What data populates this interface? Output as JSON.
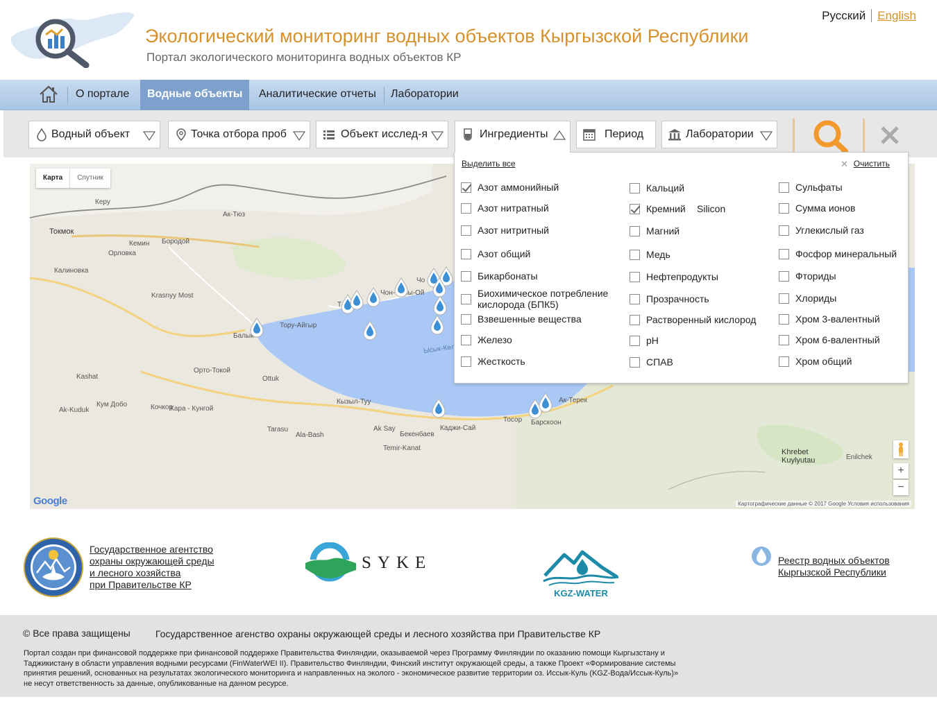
{
  "header": {
    "title": "Экологический мониторинг водных объектов Кыргызской Республики",
    "subtitle": "Портал экологического мониторинга водных объектов КР",
    "languages": {
      "ru": "Русский",
      "en": "English",
      "active": "en"
    }
  },
  "nav": {
    "items": [
      {
        "label": "О портале"
      },
      {
        "label": "Водные объекты",
        "active": true
      },
      {
        "label": "Аналитические отчеты"
      },
      {
        "label": "Лаборатории"
      }
    ]
  },
  "filters": {
    "water_object": "Водный объект",
    "sampling_point": "Точка отбора проб",
    "research_object": "Объект исслед-я",
    "ingredients": "Ингредиенты",
    "period": "Период",
    "laboratories": "Лаборатории"
  },
  "dropdown": {
    "select_all": "Выделить все",
    "clear": "Очистить",
    "columns": [
      [
        {
          "label": "Азот аммонийный",
          "checked": true
        },
        {
          "label": "Азот нитратный",
          "checked": false
        },
        {
          "label": "Азот нитритный",
          "checked": false
        },
        {
          "label": "Азот общий",
          "checked": false
        },
        {
          "label": "Бикарбонаты",
          "checked": false
        },
        {
          "label": "Биохимическое потребление кислорода (БПК5)",
          "checked": false
        },
        {
          "label": "Взвешенные вещества",
          "checked": false
        },
        {
          "label": "Железо",
          "checked": false
        },
        {
          "label": "Жесткость",
          "checked": false
        }
      ],
      [
        {
          "label": "Кальций",
          "checked": false
        },
        {
          "label": "Кремний",
          "checked": true,
          "extra": "Silicon"
        },
        {
          "label": "Магний",
          "checked": false
        },
        {
          "label": "Медь",
          "checked": false
        },
        {
          "label": "Нефтепродукты",
          "checked": false
        },
        {
          "label": "Прозрачность",
          "checked": false
        },
        {
          "label": "Растворенный кислород",
          "checked": false
        },
        {
          "label": "pH",
          "checked": false
        },
        {
          "label": "СПАВ",
          "checked": false
        }
      ],
      [
        {
          "label": "Сульфаты",
          "checked": false
        },
        {
          "label": "Сумма ионов",
          "checked": false
        },
        {
          "label": "Углекислый газ",
          "checked": false
        },
        {
          "label": "Фосфор минеральный",
          "checked": false
        },
        {
          "label": "Фториды",
          "checked": false
        },
        {
          "label": "Хлориды",
          "checked": false
        },
        {
          "label": "Хром 3-валентный",
          "checked": false
        },
        {
          "label": "Хром 6-валентный",
          "checked": false
        },
        {
          "label": "Хром общий",
          "checked": false
        }
      ]
    ]
  },
  "map": {
    "type_map": "Карта",
    "type_satellite": "Спутник",
    "lake_label": "Ысык-Көл",
    "places": [
      "Керу",
      "Ак-Тюз",
      "Токмок",
      "Кемин",
      "Бородой",
      "Орловка",
      "Калиновка",
      "Krasnyy Most",
      "Тору-Айгыр",
      "Балык",
      "Чо",
      "Чон-Сары-Ой",
      "Т",
      "Орто-Токой",
      "Ottuk",
      "Kashat",
      "Кум Добо",
      "Кочкор",
      "Кара - Кунгой",
      "Ak-Kuduk",
      "Кызыл-Туу",
      "Tarasu",
      "Ala-Bash",
      "Ak Say",
      "Бекенбаев",
      "Каджи-Сай",
      "Temir-Kanat",
      "Тосор",
      "Барскоон",
      "Ак-Терек",
      "Khrebet Kuylyutau",
      "Enilchek"
    ],
    "zoom_in": "+",
    "zoom_out": "−",
    "google": "Google",
    "attribution": "Картографические данные © 2017 Google   Условия использования"
  },
  "partners": {
    "agency_lines": [
      "Государственное агентство",
      "охраны окружающей среды",
      "и лесного хозяйства",
      "при Правительстве КР"
    ],
    "syke": "SYKE",
    "kgz_water": "KGZ-WATER",
    "registry_lines": [
      "Реестр водных объектов",
      "Кыргызской Республики"
    ]
  },
  "footer": {
    "copyright": "© Все права защищены",
    "agency": "Государственное агенство охраны окружающей среды и лесного хозяйства при Правительстве КР",
    "disclaimer_lines": [
      "Портал создан при финансовой поддержке при финансовой поддержке Правительства Финляндии, оказываемой через Программу Финляндии по оказанию помощи Кыргызстану и",
      "Таджикистану в области управления водными ресурсами (FinWaterWEI II). Правительство Финляндии, Финский институт окружающей среды, а также Проект «Формирование системы",
      "принятия решений, основанных на результатах экологического мониторинга и направленных на эколого - экономическое развитие территории оз. Иссык-Куль (KGZ-Вода/Иссык-Куль)»",
      "не несут ответственность за данные, опубликованные на данном ресурсе."
    ]
  },
  "colors": {
    "accent": "#d6912c",
    "nav_active": "#7da0cc",
    "lake": "#a9c8f5",
    "marker": "#3d8fd6"
  },
  "icons": {
    "logo": "magnifier-chart-icon",
    "home": "home-icon",
    "water": "water-drop-icon",
    "location": "location-pin-icon",
    "list": "list-icon",
    "flask": "flask-icon",
    "calendar": "calendar-icon",
    "lab": "institution-icon",
    "search": "search-icon",
    "clear": "close-icon",
    "registry": "water-drop-icon"
  }
}
